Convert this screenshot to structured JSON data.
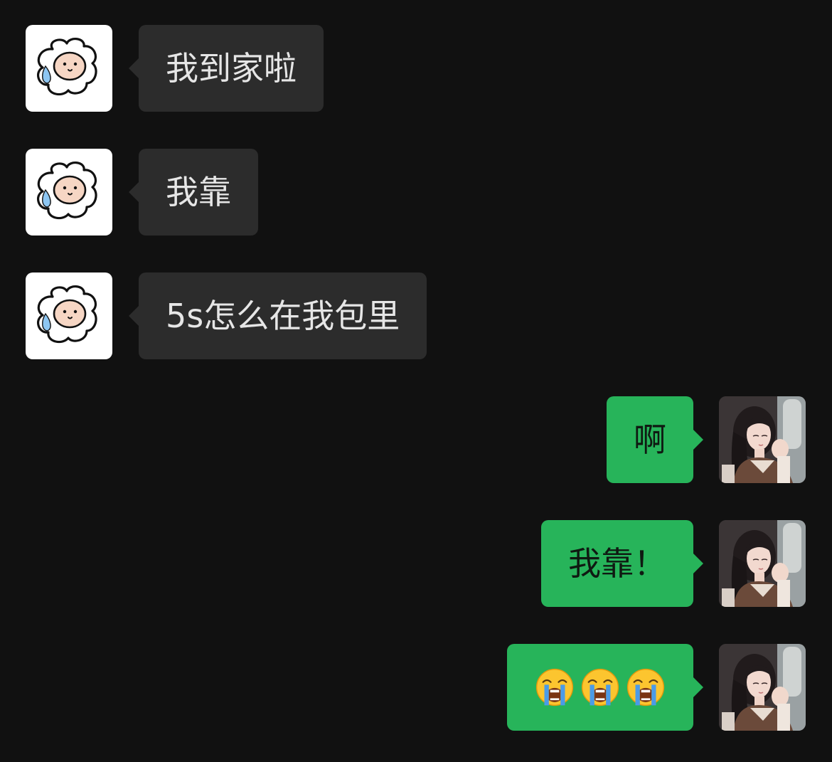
{
  "messages": [
    {
      "direction": "incoming",
      "text": "我到家啦",
      "avatar": "sheep-avatar"
    },
    {
      "direction": "incoming",
      "text": "我靠",
      "avatar": "sheep-avatar"
    },
    {
      "direction": "incoming",
      "text": "5s怎么在我包里",
      "avatar": "sheep-avatar"
    },
    {
      "direction": "outgoing",
      "text": "啊",
      "avatar": "girl-photo-avatar"
    },
    {
      "direction": "outgoing",
      "text": "我靠！",
      "avatar": "girl-photo-avatar"
    },
    {
      "direction": "outgoing",
      "emoji": [
        "loudly-crying-face",
        "loudly-crying-face",
        "loudly-crying-face"
      ],
      "avatar": "girl-photo-avatar"
    }
  ],
  "colors": {
    "background": "#111111",
    "incoming_bubble": "#2c2c2c",
    "outgoing_bubble": "#27b45a",
    "incoming_text": "#e6e6e6",
    "outgoing_text": "#0f1a12"
  }
}
